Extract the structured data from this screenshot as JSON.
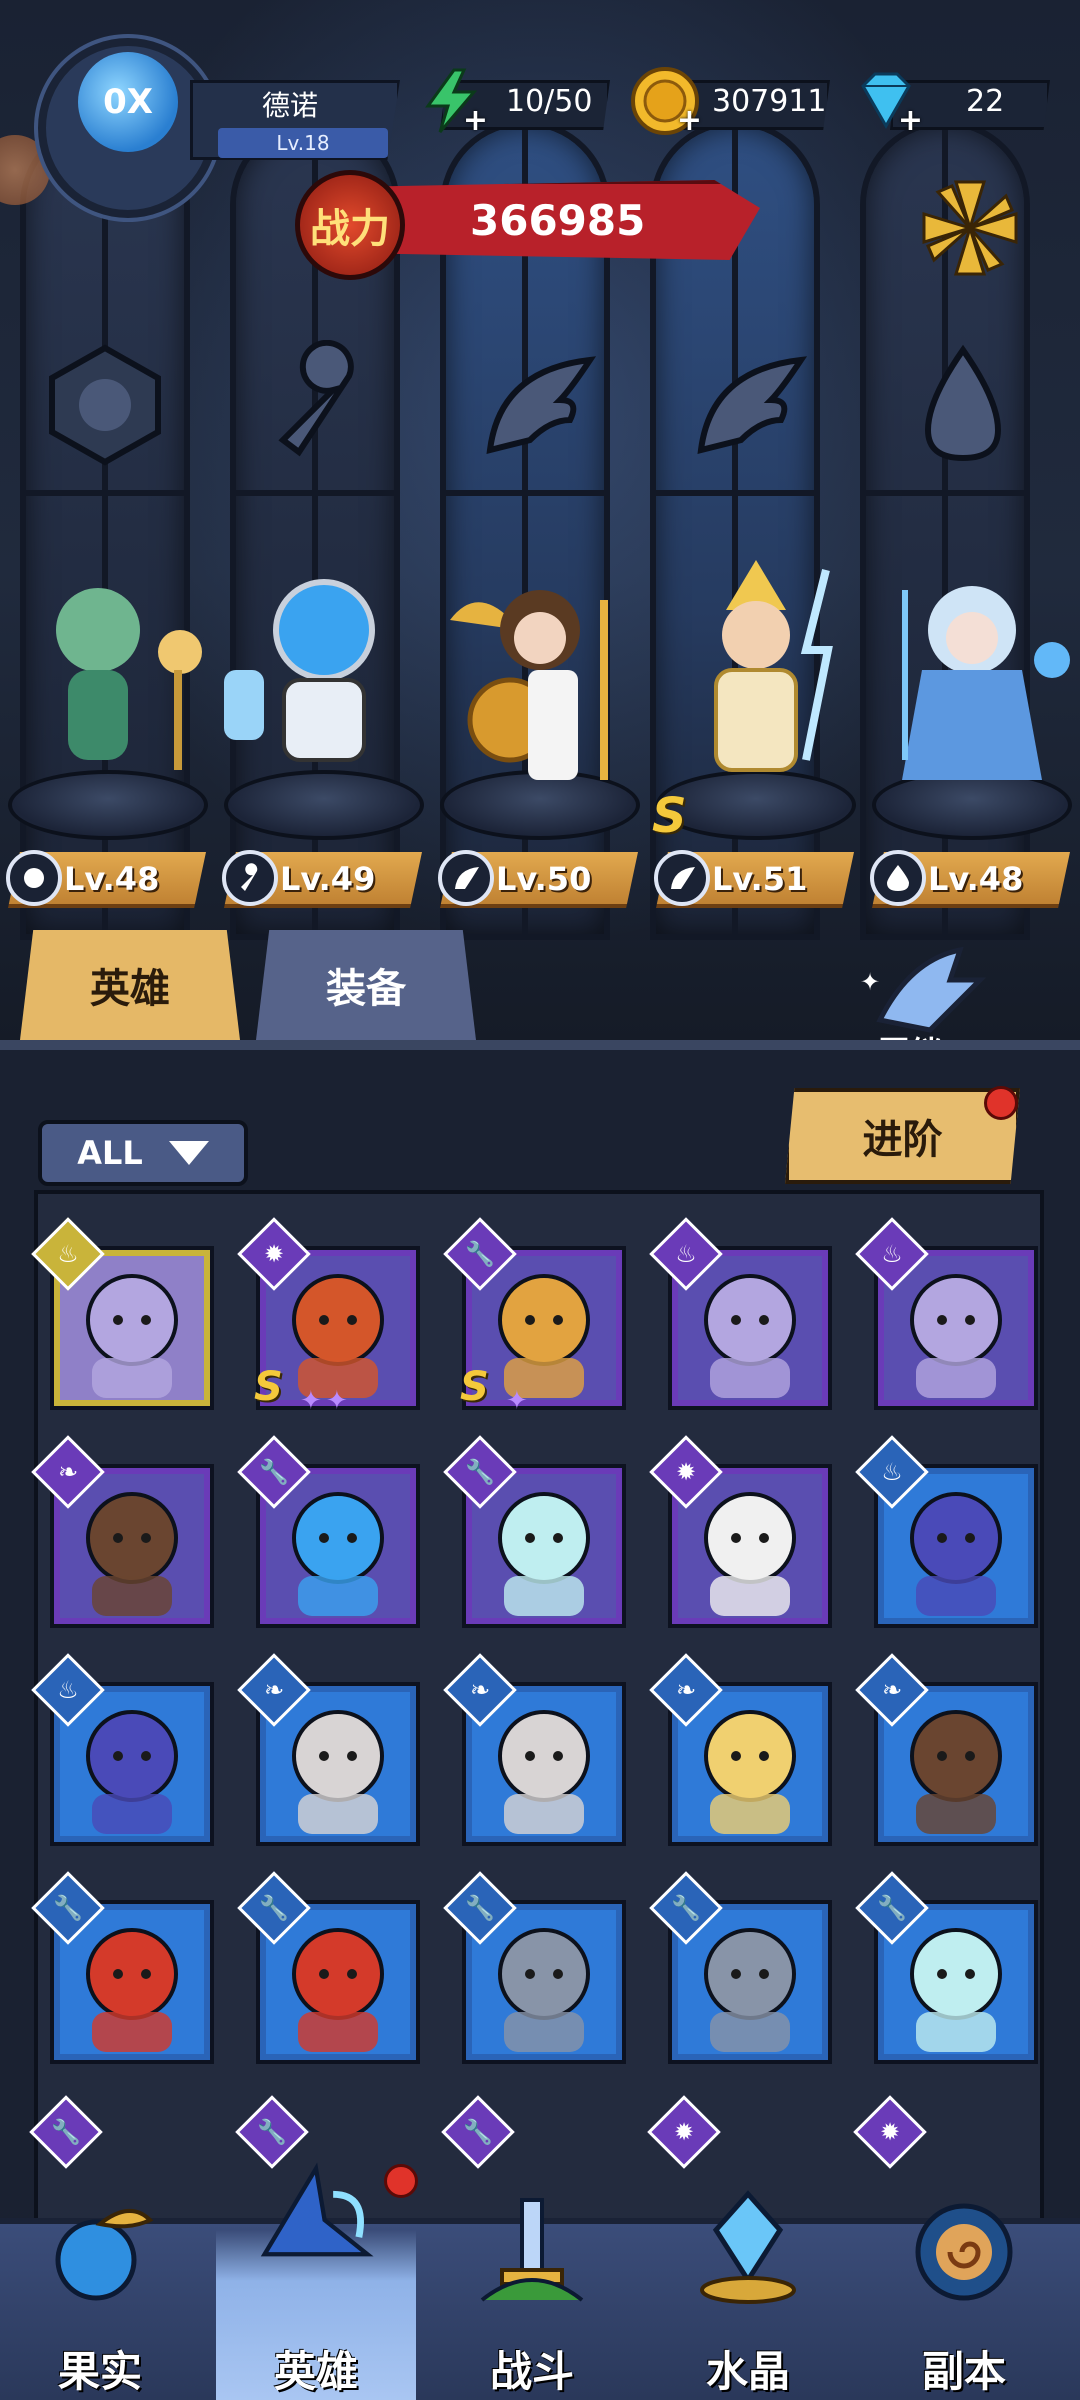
{
  "player": {
    "name": "德诺",
    "level": "Lv.18",
    "avatar_mark": "0X"
  },
  "resources": [
    {
      "icon": "energy-bolt-icon",
      "value": "10/50"
    },
    {
      "icon": "gold-coin-icon",
      "value": "307911"
    },
    {
      "icon": "diamond-gem-icon",
      "value": "22"
    }
  ],
  "power": {
    "emblem_label": "战力",
    "value": "366985"
  },
  "lineup": [
    {
      "class_icon": "beast-claw-icon",
      "level": "Lv.48"
    },
    {
      "class_icon": "wrench-icon",
      "level": "Lv.49"
    },
    {
      "class_icon": "wing-icon",
      "level": "Lv.50"
    },
    {
      "class_icon": "wing-icon",
      "level": "Lv.51",
      "rank": "S"
    },
    {
      "class_icon": "flame-icon",
      "level": "Lv.48"
    }
  ],
  "tabs": [
    {
      "label": "英雄",
      "active": true
    },
    {
      "label": "装备",
      "active": false
    }
  ],
  "bond": {
    "label": "羁绊"
  },
  "filter": {
    "label": "ALL"
  },
  "advance_button": {
    "label": "进阶"
  },
  "hero_cards": [
    {
      "rarity": "gold",
      "class": "flame",
      "portrait": "bandaged-nun"
    },
    {
      "rarity": "purple",
      "class": "beast",
      "portrait": "lion-warrior",
      "rank": "S",
      "stars": 2
    },
    {
      "rarity": "purple",
      "class": "wrench",
      "portrait": "robot-gunner",
      "rank": "S",
      "stars": 1
    },
    {
      "rarity": "purple",
      "class": "flame",
      "portrait": "bandaged-nun"
    },
    {
      "rarity": "purple",
      "class": "flame",
      "portrait": "bandaged-nun"
    },
    {
      "rarity": "purple",
      "class": "wing",
      "portrait": "laurel-goddess"
    },
    {
      "rarity": "purple",
      "class": "wrench",
      "portrait": "fish-tank-diver"
    },
    {
      "rarity": "purple",
      "class": "wrench",
      "portrait": "ghost-orb"
    },
    {
      "rarity": "purple",
      "class": "beast",
      "portrait": "panda-fighter"
    },
    {
      "rarity": "blue",
      "class": "flame",
      "portrait": "brain-wizard"
    },
    {
      "rarity": "blue",
      "class": "flame",
      "portrait": "brain-wizard"
    },
    {
      "rarity": "blue",
      "class": "wing",
      "portrait": "vampire-lady"
    },
    {
      "rarity": "blue",
      "class": "wing",
      "portrait": "vampire-lady"
    },
    {
      "rarity": "blue",
      "class": "wing",
      "portrait": "golden-paladin"
    },
    {
      "rarity": "blue",
      "class": "wing",
      "portrait": "laurel-goddess"
    },
    {
      "rarity": "blue",
      "class": "wrench",
      "portrait": "red-diver-bot"
    },
    {
      "rarity": "blue",
      "class": "wrench",
      "portrait": "red-diver-bot"
    },
    {
      "rarity": "blue",
      "class": "wrench",
      "portrait": "steel-mech"
    },
    {
      "rarity": "blue",
      "class": "wrench",
      "portrait": "steel-mech"
    },
    {
      "rarity": "blue",
      "class": "wrench",
      "portrait": "ghost-orb"
    }
  ],
  "nav": [
    {
      "label": "果实",
      "icon": "fruit-icon",
      "active": false
    },
    {
      "label": "英雄",
      "icon": "wizard-hat-icon",
      "active": true,
      "badge": true
    },
    {
      "label": "战斗",
      "icon": "battle-sword-icon",
      "active": false
    },
    {
      "label": "水晶",
      "icon": "crystal-icon",
      "active": false
    },
    {
      "label": "副本",
      "icon": "portal-icon",
      "active": false
    }
  ],
  "colors": {
    "gold_accent": "#e5b867",
    "power_red": "#b8212a",
    "rarity_purple": "#6a3bb8",
    "rarity_blue": "#2a64b8",
    "rarity_gold": "#c9b43a",
    "badge_red": "#e0332a"
  }
}
